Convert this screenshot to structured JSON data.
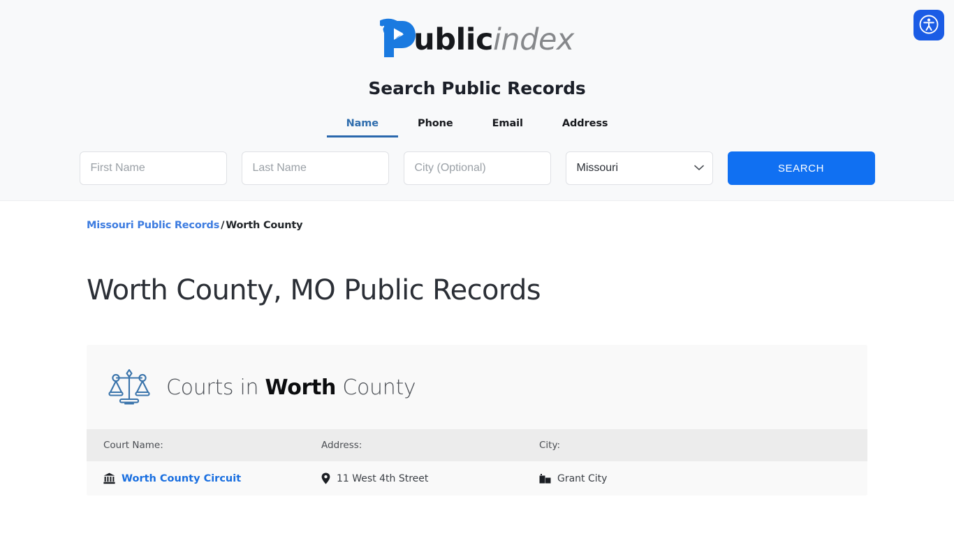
{
  "logo": {
    "word_primary": "ublic",
    "word_secondary": "index",
    "mark_color": "#1a7ae0"
  },
  "header": {
    "search_title": "Search Public Records",
    "tabs": [
      {
        "label": "Name",
        "active": true
      },
      {
        "label": "Phone",
        "active": false
      },
      {
        "label": "Email",
        "active": false
      },
      {
        "label": "Address",
        "active": false
      }
    ],
    "active_tab_color": "#2f6dad",
    "form": {
      "first_name_placeholder": "First Name",
      "first_name_value": "",
      "last_name_placeholder": "Last Name",
      "last_name_value": "",
      "city_placeholder": "City (Optional)",
      "city_value": "",
      "state_selected": "Missouri",
      "search_button_label": "SEARCH",
      "search_button_color": "#1070f2"
    }
  },
  "breadcrumb": {
    "parent_label": "Missouri Public Records",
    "separator": "/",
    "current_label": "Worth County"
  },
  "main": {
    "page_title": "Worth County, MO Public Records"
  },
  "courts_card": {
    "heading_prefix": "Courts in ",
    "heading_emphasis": "Worth",
    "heading_suffix": " County",
    "icon": "scales-of-justice-icon",
    "columns": {
      "name": "Court Name:",
      "address": "Address:",
      "city": "City:"
    },
    "rows": [
      {
        "name": "Worth County Circuit",
        "name_icon": "courthouse-icon",
        "address": "11 West 4th Street",
        "address_icon": "map-pin-icon",
        "city": "Grant City",
        "city_icon": "city-building-icon"
      }
    ]
  },
  "accessibility": {
    "label": "Accessibility options",
    "icon": "accessibility-person-icon",
    "color": "#1b5ce5"
  }
}
